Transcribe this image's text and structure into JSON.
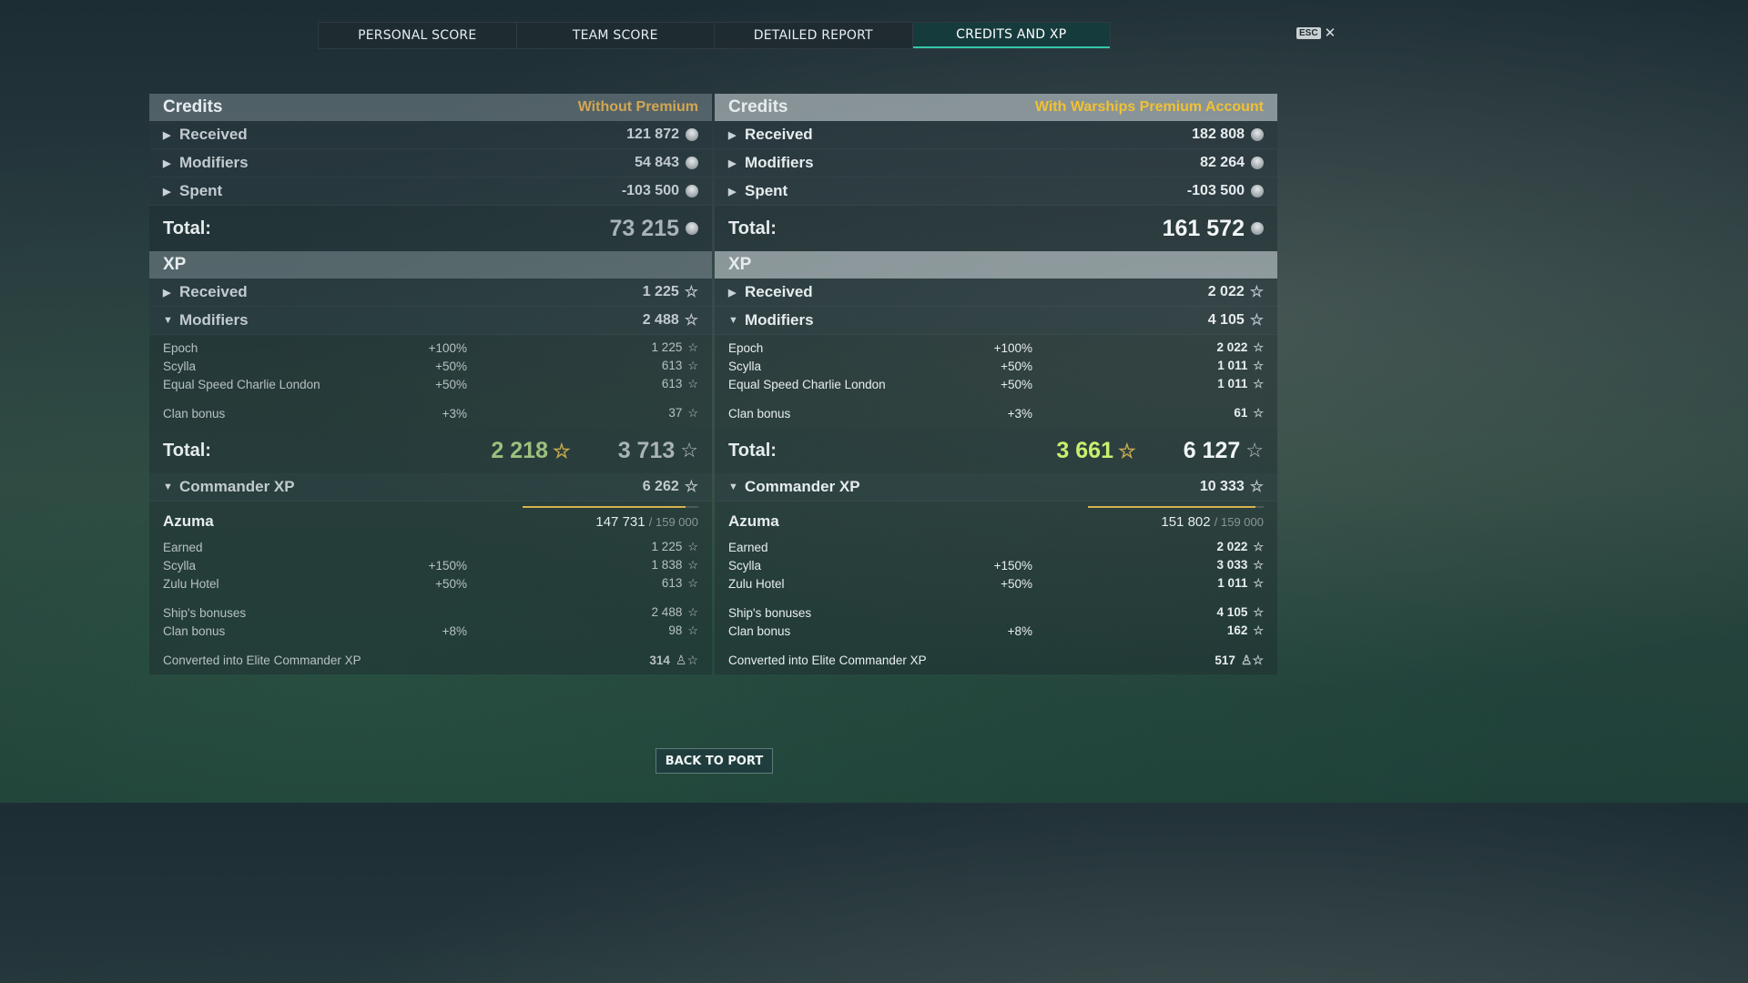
{
  "tabs": [
    "PERSONAL SCORE",
    "TEAM SCORE",
    "DETAILED REPORT",
    "CREDITS AND XP"
  ],
  "active_tab": "CREDITS AND XP",
  "esc_label": "ESC",
  "close_glyph": "✕",
  "back_button": "BACK TO PORT",
  "left": {
    "credits_title": "Credits",
    "account_label": "Without Premium",
    "credits_rows": [
      {
        "label": "Received",
        "value": "121 872"
      },
      {
        "label": "Modifiers",
        "value": "54 843"
      },
      {
        "label": "Spent",
        "value": "-103 500"
      }
    ],
    "credits_total_label": "Total:",
    "credits_total": "73 215",
    "xp_title": "XP",
    "xp_received_label": "Received",
    "xp_received": "1 225",
    "xp_modifiers_label": "Modifiers",
    "xp_modifiers": "2 488",
    "xp_mods": [
      {
        "name": "Epoch",
        "pct": "+100%",
        "value": "1 225"
      },
      {
        "name": "Scylla",
        "pct": "+50%",
        "value": "613"
      },
      {
        "name": "Equal Speed Charlie London",
        "pct": "+50%",
        "value": "613"
      }
    ],
    "xp_clan": {
      "name": "Clan bonus",
      "pct": "+3%",
      "value": "37"
    },
    "xp_total_label": "Total:",
    "xp_total_green": "2 218",
    "xp_total": "3 713",
    "cmdr_label": "Commander XP",
    "cmdr_value": "6 262",
    "cmdr_name": "Azuma",
    "cmdr_progress": "147 731",
    "cmdr_max": "/ 159 000",
    "cmdr_progress_fraction": 0.929,
    "cmdr_rows": [
      {
        "name": "Earned",
        "pct": "",
        "value": "1 225"
      },
      {
        "name": "Scylla",
        "pct": "+150%",
        "value": "1 838"
      },
      {
        "name": "Zulu Hotel",
        "pct": "+50%",
        "value": "613"
      }
    ],
    "cmdr_rows2": [
      {
        "name": "Ship's bonuses",
        "pct": "",
        "value": "2 488"
      },
      {
        "name": "Clan bonus",
        "pct": "+8%",
        "value": "98"
      }
    ],
    "elite_label": "Converted into Elite Commander XP",
    "elite_value": "314"
  },
  "right": {
    "credits_title": "Credits",
    "account_label": "With Warships Premium Account",
    "credits_rows": [
      {
        "label": "Received",
        "value": "182 808"
      },
      {
        "label": "Modifiers",
        "value": "82 264"
      },
      {
        "label": "Spent",
        "value": "-103 500"
      }
    ],
    "credits_total_label": "Total:",
    "credits_total": "161 572",
    "xp_title": "XP",
    "xp_received_label": "Received",
    "xp_received": "2 022",
    "xp_modifiers_label": "Modifiers",
    "xp_modifiers": "4 105",
    "xp_mods": [
      {
        "name": "Epoch",
        "pct": "+100%",
        "value": "2 022"
      },
      {
        "name": "Scylla",
        "pct": "+50%",
        "value": "1 011"
      },
      {
        "name": "Equal Speed Charlie London",
        "pct": "+50%",
        "value": "1 011"
      }
    ],
    "xp_clan": {
      "name": "Clan bonus",
      "pct": "+3%",
      "value": "61"
    },
    "xp_total_label": "Total:",
    "xp_total_green": "3 661",
    "xp_total": "6 127",
    "cmdr_label": "Commander XP",
    "cmdr_value": "10 333",
    "cmdr_name": "Azuma",
    "cmdr_progress": "151 802",
    "cmdr_max": "/ 159 000",
    "cmdr_progress_fraction": 0.955,
    "cmdr_rows": [
      {
        "name": "Earned",
        "pct": "",
        "value": "2 022"
      },
      {
        "name": "Scylla",
        "pct": "+150%",
        "value": "3 033"
      },
      {
        "name": "Zulu Hotel",
        "pct": "+50%",
        "value": "1 011"
      }
    ],
    "cmdr_rows2": [
      {
        "name": "Ship's bonuses",
        "pct": "",
        "value": "4 105"
      },
      {
        "name": "Clan bonus",
        "pct": "+8%",
        "value": "162"
      }
    ],
    "elite_label": "Converted into Elite Commander XP",
    "elite_value": "517"
  }
}
